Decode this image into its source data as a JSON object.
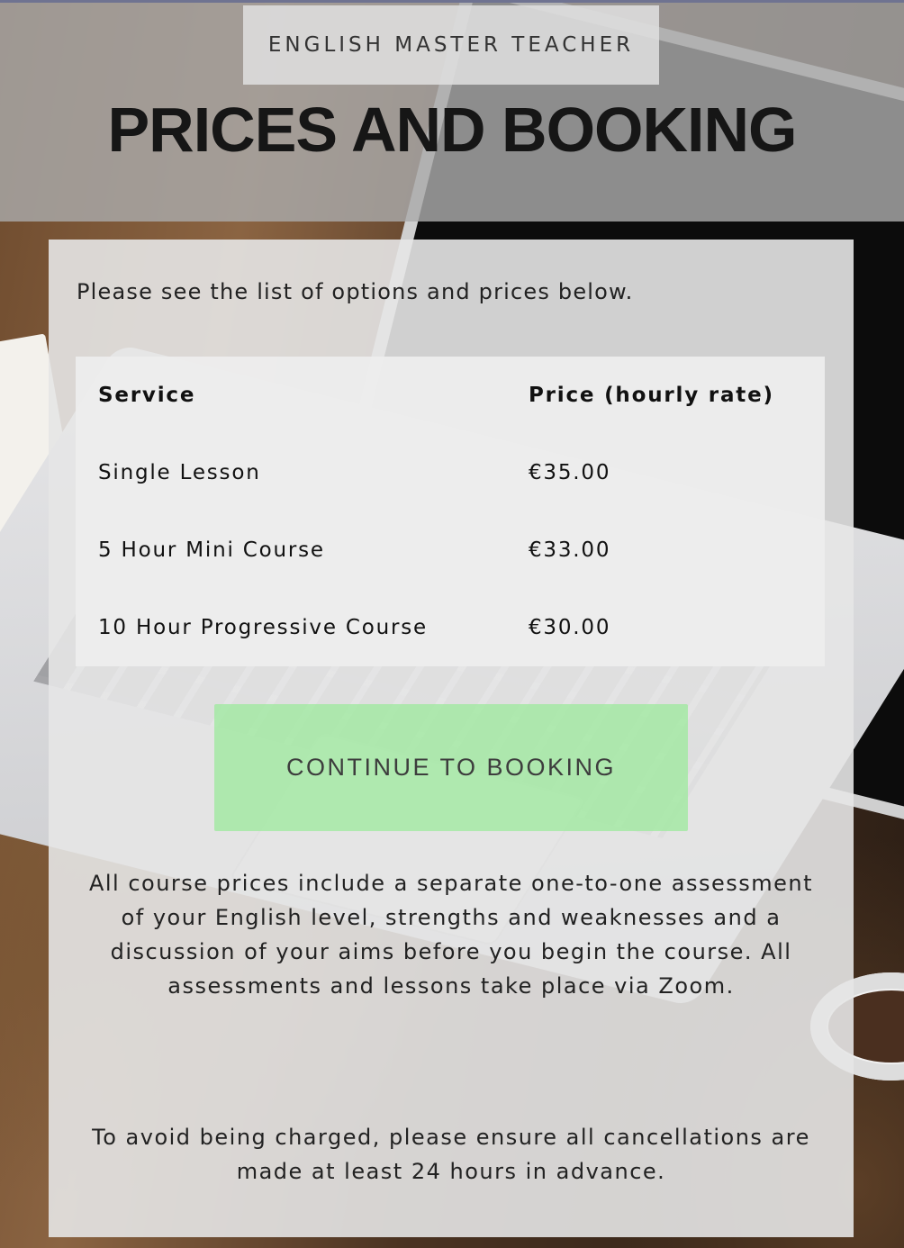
{
  "header": {
    "brand": "English Master Teacher",
    "title": "PRICES AND BOOKING"
  },
  "main": {
    "intro": "Please see the list of options and prices below.",
    "table": {
      "headers": [
        "Service",
        "Price (hourly rate)"
      ],
      "rows": [
        [
          "Single Lesson",
          "€35.00"
        ],
        [
          "5 Hour Mini Course",
          "€33.00"
        ],
        [
          "10 Hour Progressive Course",
          "€30.00"
        ]
      ]
    },
    "cta_label": "CONTINUE TO BOOKING",
    "paragraph1": "All course prices include a separate one-to-one assessment of your English level, strengths and weaknesses and a discussion of your aims before you begin the course. All assessments and lessons take place via Zoom.",
    "paragraph2": "To avoid being charged, please ensure all cancellations are made at least 24 hours in advance."
  },
  "colors": {
    "cta_background": "#9cea9c",
    "header_overlay": "#aaaaaa",
    "top_rule": "#6f7391"
  }
}
